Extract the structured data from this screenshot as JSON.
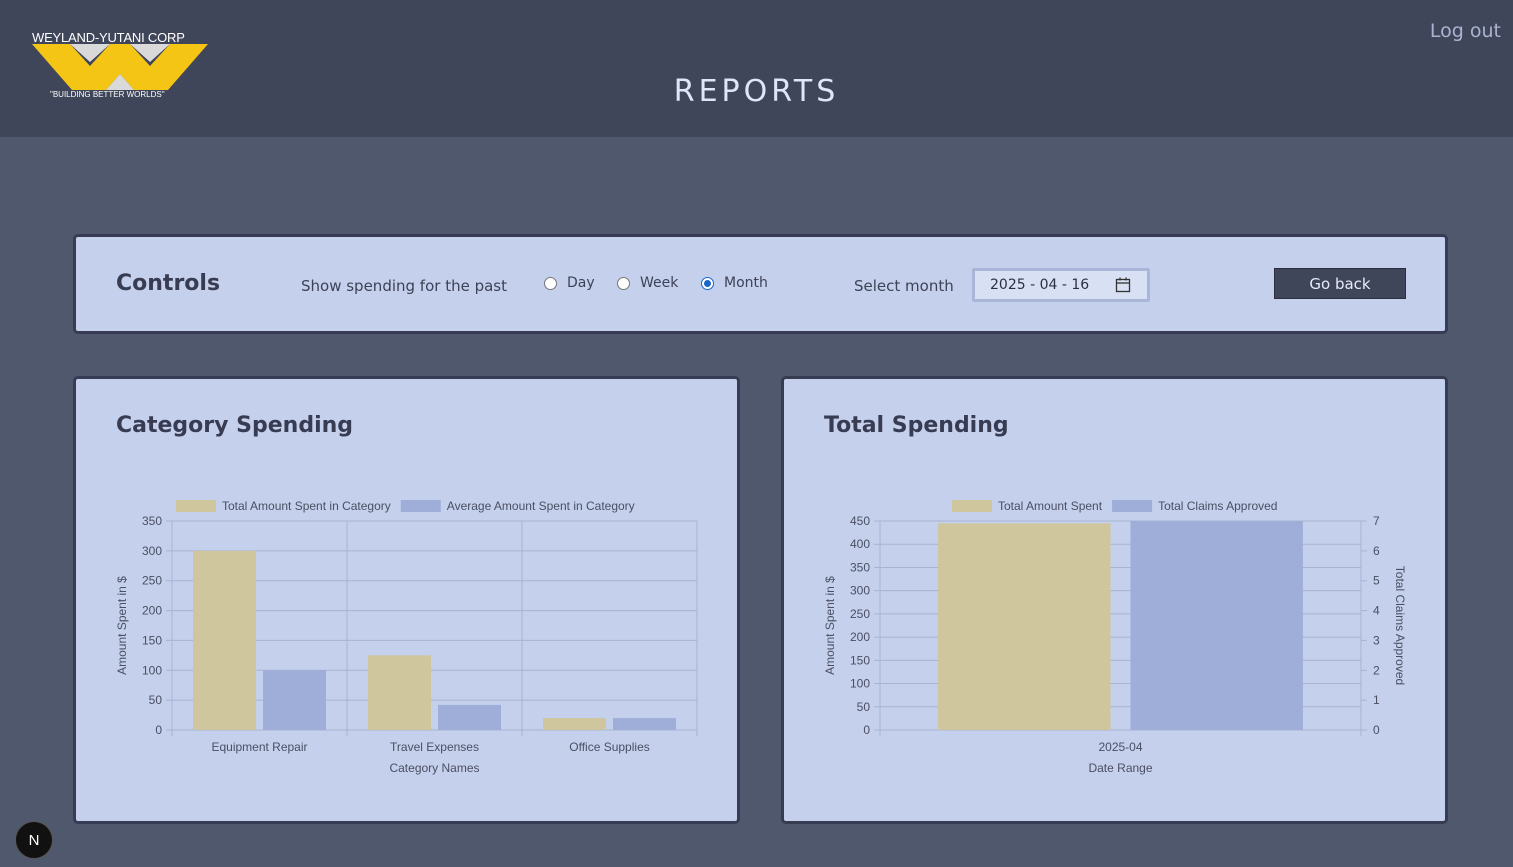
{
  "header": {
    "logo_top": "WEYLAND-YUTANI CORP",
    "logo_bottom": "\"BUILDING BETTER WORLDS\"",
    "title": "REPORTS",
    "logout_label": "Log out"
  },
  "controls": {
    "title": "Controls",
    "show_label": "Show spending for the past",
    "options": [
      {
        "label": "Day",
        "checked": false
      },
      {
        "label": "Week",
        "checked": false
      },
      {
        "label": "Month",
        "checked": true
      }
    ],
    "month_label": "Select month",
    "date_value": "2025 - 04 - 16",
    "go_back_label": "Go back"
  },
  "colors": {
    "tan": "#cfc69d",
    "blue": "#9eaed9",
    "panel": "#c5d0ec"
  },
  "category_panel_title": "Category Spending",
  "total_panel_title": "Total Spending",
  "chart_data": [
    {
      "type": "bar",
      "title": "",
      "categories": [
        "Equipment Repair",
        "Travel Expenses",
        "Office Supplies"
      ],
      "series": [
        {
          "name": "Total Amount Spent in Category",
          "values": [
            300,
            125,
            20
          ]
        },
        {
          "name": "Average Amount Spent in Category",
          "values": [
            100,
            42,
            20
          ]
        }
      ],
      "xlabel": "Category Names",
      "ylabel": "Amount Spent in $",
      "ylim": [
        0,
        350
      ],
      "yticks": [
        0,
        50,
        100,
        150,
        200,
        250,
        300,
        350
      ],
      "grid": true,
      "legend": "top"
    },
    {
      "type": "bar",
      "title": "",
      "categories": [
        "2025-04"
      ],
      "series": [
        {
          "name": "Total Amount Spent",
          "values": [
            445
          ],
          "axis": "left"
        },
        {
          "name": "Total Claims Approved",
          "values": [
            7
          ],
          "axis": "right"
        }
      ],
      "xlabel": "Date Range",
      "ylabel": "Amount Spent in $",
      "y2label": "Total Claims Approved",
      "ylim": [
        0,
        450
      ],
      "yticks": [
        0,
        50,
        100,
        150,
        200,
        250,
        300,
        350,
        400,
        450
      ],
      "y2lim": [
        0,
        7
      ],
      "y2ticks": [
        0,
        1,
        2,
        3,
        4,
        5,
        6,
        7
      ],
      "grid": true,
      "legend": "top"
    }
  ],
  "badge_label": "N"
}
